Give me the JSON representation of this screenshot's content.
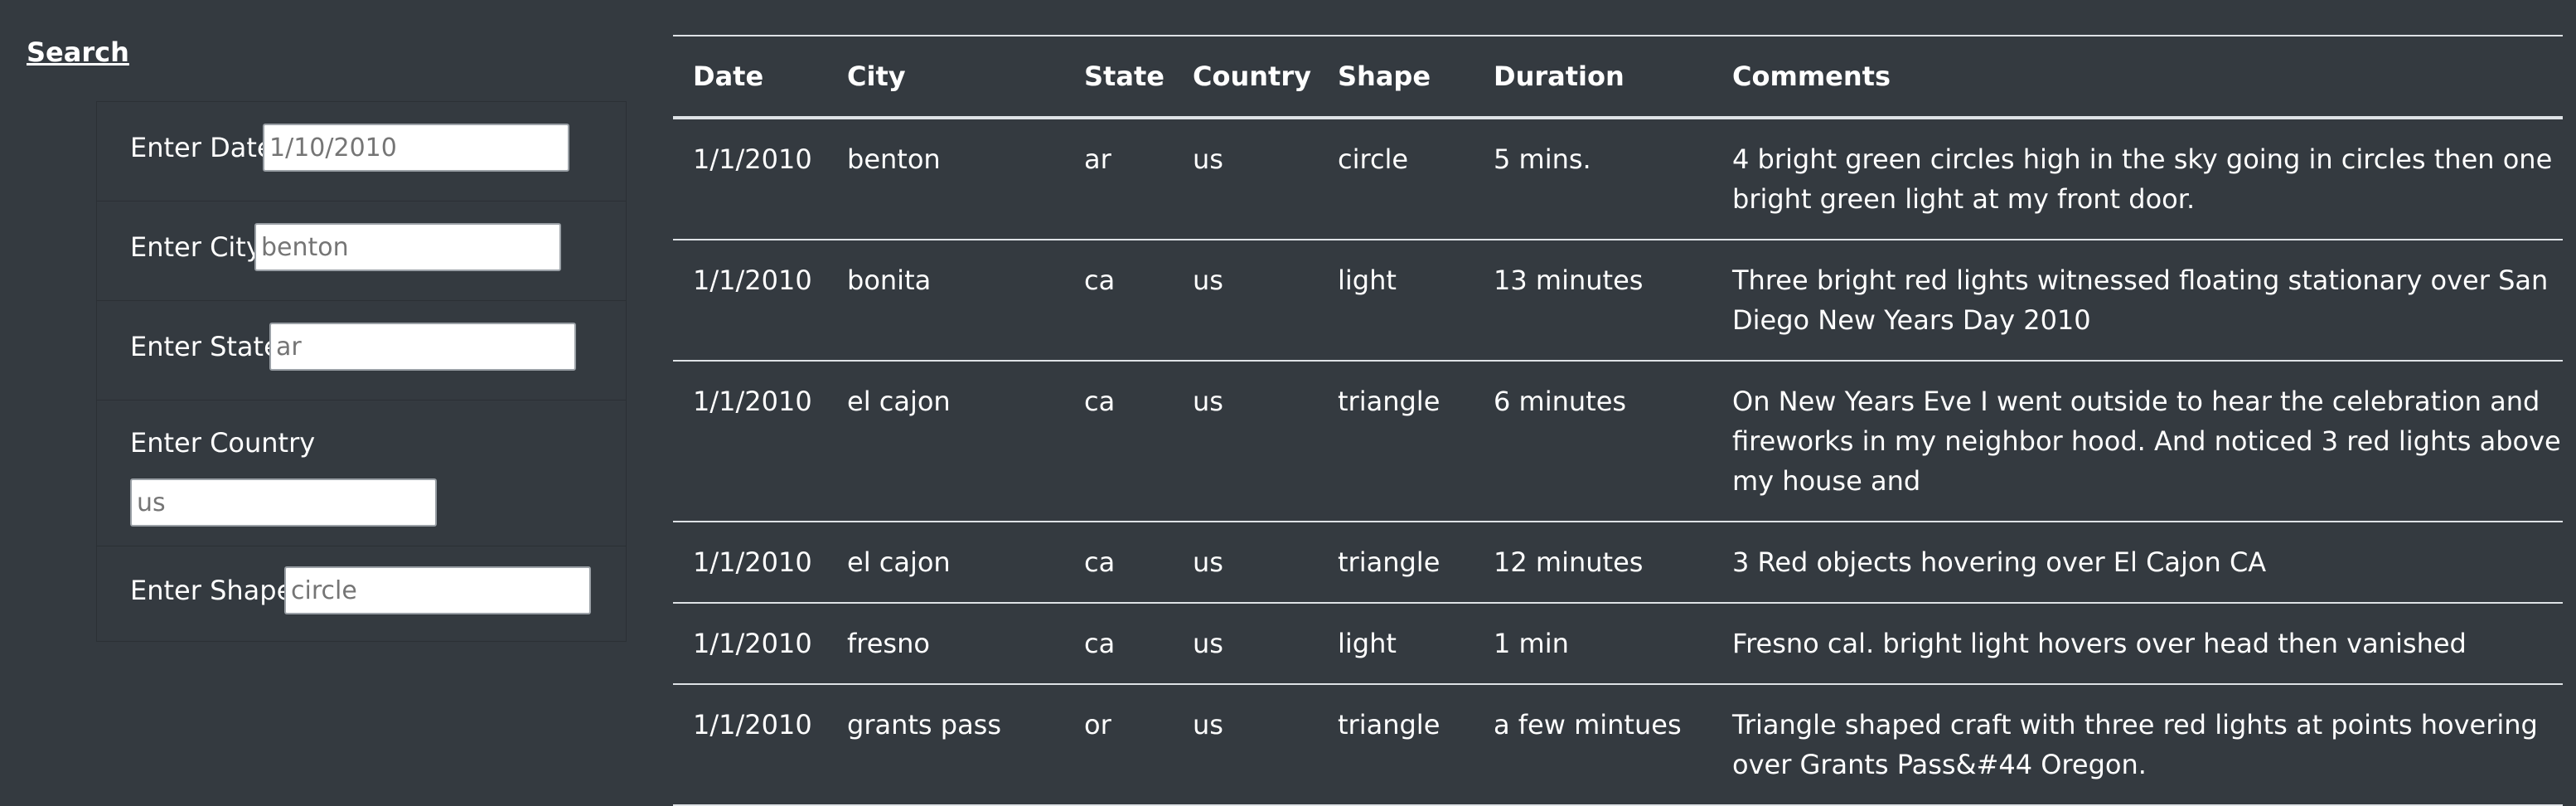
{
  "filters": {
    "title": "Search",
    "date": {
      "label": "Enter Date",
      "placeholder": "1/10/2010"
    },
    "city": {
      "label": "Enter City",
      "placeholder": "benton"
    },
    "state": {
      "label": "Enter State",
      "placeholder": "ar"
    },
    "country": {
      "label": "Enter Country",
      "placeholder": "us"
    },
    "shape": {
      "label": "Enter Shape",
      "placeholder": "circle"
    }
  },
  "table": {
    "headers": {
      "date": "Date",
      "city": "City",
      "state": "State",
      "country": "Country",
      "shape": "Shape",
      "duration": "Duration",
      "comments": "Comments"
    },
    "rows": [
      {
        "date": "1/1/2010",
        "city": "benton",
        "state": "ar",
        "country": "us",
        "shape": "circle",
        "duration": "5 mins.",
        "comments": "4 bright green circles high in the sky going in circles then one bright green light at my front door."
      },
      {
        "date": "1/1/2010",
        "city": "bonita",
        "state": "ca",
        "country": "us",
        "shape": "light",
        "duration": "13 minutes",
        "comments": "Three bright red lights witnessed floating stationary over San Diego New Years Day 2010"
      },
      {
        "date": "1/1/2010",
        "city": "el cajon",
        "state": "ca",
        "country": "us",
        "shape": "triangle",
        "duration": "6 minutes",
        "comments": "On New Years Eve I went outside to hear the celebration and fireworks in my neighbor hood. And noticed 3 red lights above my house and"
      },
      {
        "date": "1/1/2010",
        "city": "el cajon",
        "state": "ca",
        "country": "us",
        "shape": "triangle",
        "duration": "12 minutes",
        "comments": "3 Red objects hovering over El Cajon CA"
      },
      {
        "date": "1/1/2010",
        "city": "fresno",
        "state": "ca",
        "country": "us",
        "shape": "light",
        "duration": "1 min",
        "comments": "Fresno cal. bright light hovers over head then vanished"
      },
      {
        "date": "1/1/2010",
        "city": "grants pass",
        "state": "or",
        "country": "us",
        "shape": "triangle",
        "duration": "a few mintues",
        "comments": "Triangle shaped craft with three red lights at points hovering over Grants Pass&#44 Oregon."
      }
    ]
  }
}
